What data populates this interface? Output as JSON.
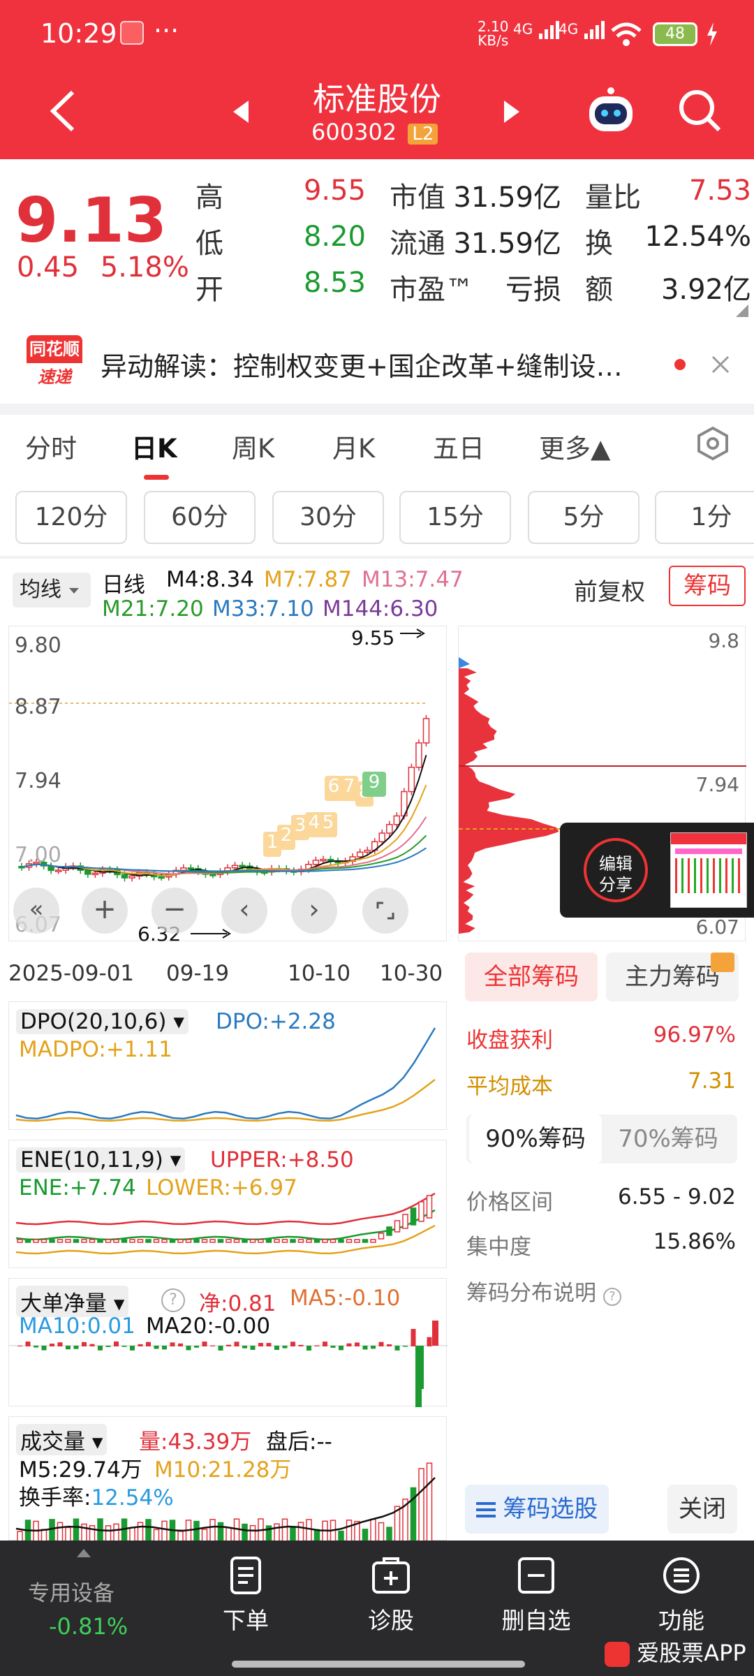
{
  "status_bar": {
    "time": "10:29",
    "dots": "···",
    "net_speed_top": "2.10",
    "net_speed_bottom": "KB/s",
    "sig1": "4G",
    "sig2": "4G",
    "battery": "48"
  },
  "nav": {
    "title": "标准股份",
    "code": "600302",
    "level": "L2"
  },
  "quote": {
    "price": "9.13",
    "change": "0.45",
    "change_pct": "5.18%",
    "high_label": "高",
    "high": "9.55",
    "low_label": "低",
    "low": "8.20",
    "open_label": "开",
    "open": "8.53",
    "mcap_label": "市值",
    "mcap": "31.59亿",
    "float_label": "流通",
    "float": "31.59亿",
    "pe_label": "市盈™",
    "pe": "亏损",
    "vr_label": "量比",
    "vr": "7.53",
    "turn_label": "换",
    "turn": "12.54%",
    "amt_label": "额",
    "amt": "3.92亿"
  },
  "news": {
    "logo_top": "同花顺",
    "logo_bottom": "速递",
    "text": "异动解读：控制权变更+国企改革+缝制设…"
  },
  "tabs": [
    "分时",
    "日K",
    "周K",
    "月K",
    "五日",
    "更多▲"
  ],
  "periods": [
    "120分",
    "60分",
    "30分",
    "15分",
    "5分",
    "1分"
  ],
  "kline": {
    "ma_select": "均线",
    "label": "日线",
    "m4": "M4:8.34",
    "m7": "M7:7.87",
    "m13": "M13:7.47",
    "m21": "M21:7.20",
    "m33": "M33:7.10",
    "m144": "M144:6.30",
    "adjust": "前复权",
    "chips_btn": "筹码",
    "y_ticks": [
      "9.80",
      "8.87",
      "7.94",
      "7.00",
      "6.07"
    ],
    "high_mark": "9.55",
    "low_mark": "6.32",
    "seq_numbers": [
      "1",
      "2",
      "3",
      "4",
      "5",
      "6",
      "7",
      "8",
      "9"
    ],
    "dates": [
      "2025-09-01",
      "09-19",
      "10-10",
      "10-30"
    ]
  },
  "chips_axis": [
    "9.8",
    "7.94",
    "6.07"
  ],
  "share_btn": [
    "编辑",
    "分享"
  ],
  "chips_panel": {
    "tab_all": "全部筹码",
    "tab_main": "主力筹码",
    "profit_label": "收盘获利",
    "profit": "96.97%",
    "cost_label": "平均成本",
    "cost": "7.31",
    "tab90": "90%筹码",
    "tab70": "70%筹码",
    "range_label": "价格区间",
    "range": "6.55 - 9.02",
    "conc_label": "集中度",
    "conc": "15.86%",
    "explain": "筹码分布说明",
    "select_btn": "筹码选股",
    "close_btn": "关闭"
  },
  "dpo": {
    "name": "DPO(20,10,6)",
    "dpo": "DPO:+2.28",
    "madpo": "MADPO:+1.11"
  },
  "ene": {
    "name": "ENE(10,11,9)",
    "upper": "UPPER:+8.50",
    "ene": "ENE:+7.74",
    "lower": "LOWER:+6.97"
  },
  "bigorder": {
    "name": "大单净量",
    "net": "净:0.81",
    "ma5": "MA5:-0.10",
    "ma10": "MA10:0.01",
    "ma20": "MA20:-0.00"
  },
  "volume": {
    "name": "成交量",
    "vol": "量:43.39万",
    "after": "盘后:--",
    "m5": "M5:29.74万",
    "m10": "M10:21.28万",
    "turn_label": "换手率:",
    "turn": "12.54%"
  },
  "bottom_nav": {
    "market_label": "专用设备",
    "market_change": "-0.81%",
    "items": [
      "下单",
      "诊股",
      "删自选",
      "功能"
    ]
  },
  "watermark": "爱股票APP",
  "colors": {
    "up": "#e0303a",
    "down": "#1a9a30",
    "header": "#f0323f",
    "m4": "#111111",
    "m7": "#e3a21a",
    "m13": "#e07090",
    "m21": "#2a9a2a",
    "m33": "#2a7abf",
    "m144": "#7a3a9a"
  }
}
